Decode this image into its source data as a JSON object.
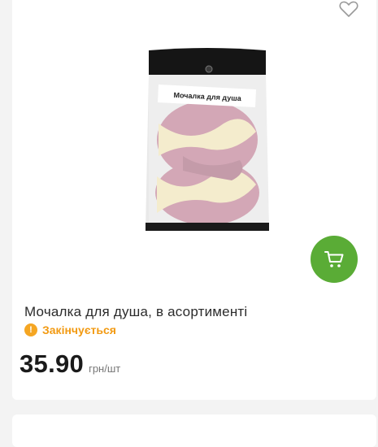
{
  "product": {
    "title": "Мочалка для душа, в асортименті",
    "status_text": "Закінчується",
    "status_icon": "exclamation-icon",
    "price": "35.90",
    "unit": "грн/шт",
    "package_label": "Мочалка для душа"
  },
  "colors": {
    "cart_button": "#5aac36",
    "status": "#f29a12",
    "stripe_pink": "#c58a9e",
    "stripe_cream": "#f1e6bd"
  },
  "icons": {
    "wishlist": "heart-outline-icon",
    "cart": "shopping-cart-icon"
  }
}
